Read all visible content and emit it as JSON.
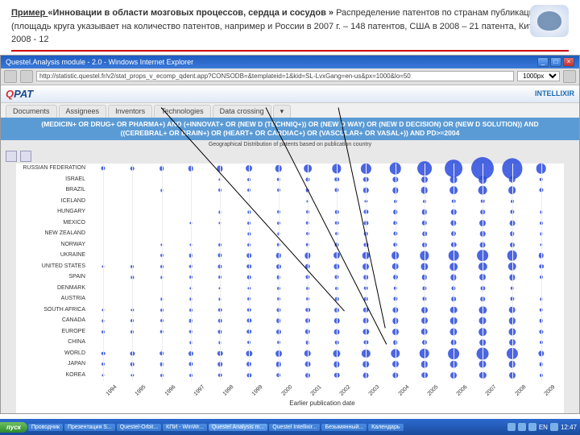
{
  "header": {
    "prefix_bold": "Пример ",
    "title_bold": "«Инновации в области мозговых процессов, сердца и сосудов »",
    "suffix": " Распределение патентов по странам публикации (площадь круга указывает на количество патентов, например и России в 2007 г. – 148 патентов, США в 2008 – 21 патента, Китай в 2008 - 12"
  },
  "browser": {
    "window_title": "Questel.Analysis module - 2.0 - Windows Internet Explorer",
    "address": "http://statistic.questel.fr/v2/stat_props_v_ecomp_qdent.app?CONSODB=&templateid=1&kid=SL-LvxGang=en-us&px=1000&lo=50",
    "dropdown_value": "1000px"
  },
  "app": {
    "logo_q": "Q",
    "logo_rest": "PAT",
    "brand": "INTELLIXIR",
    "tabs": [
      "Documents",
      "Assignees",
      "Inventors",
      "Technologies",
      "Data crossing",
      "▾"
    ]
  },
  "query": {
    "line1": "(MEDICIN+ OR DRUG+ OR PHARMA+) AND (+INNOVAT+ OR (NEW D (TECHNIQ+)) OR (NEW D WAY) OR (NEW D DECISION) OR (NEW D SOLUTION)) AND",
    "line2": "((CEREBRAL+ OR BRAIN+) OR (HEART+ OR CARDIAC+) OR (VASCULAR+ OR VASAL+)) AND PD>=2004"
  },
  "chart": {
    "subtitle": "Geographical Distribution of patents based on publication country",
    "xlabel": "Earlier publication date"
  },
  "chart_data": {
    "type": "bubble",
    "xlabel": "Earlier publication date",
    "ylabel": "Country",
    "x": [
      "1994",
      "1995",
      "1996",
      "1997",
      "1998",
      "1999",
      "2000",
      "2001",
      "2002",
      "2003",
      "2004",
      "2005",
      "2006",
      "2007",
      "2008",
      "2009"
    ],
    "series": [
      {
        "name": "RUSSIAN FEDERATION",
        "values": [
          5,
          4,
          6,
          8,
          10,
          12,
          14,
          18,
          24,
          28,
          40,
          60,
          90,
          148,
          120,
          30
        ]
      },
      {
        "name": "ISRAEL",
        "values": [
          0,
          0,
          0,
          0,
          2,
          3,
          4,
          5,
          6,
          8,
          10,
          12,
          15,
          18,
          14,
          4
        ]
      },
      {
        "name": "BRAZIL",
        "values": [
          0,
          0,
          2,
          0,
          3,
          3,
          3,
          4,
          5,
          8,
          10,
          14,
          18,
          22,
          18,
          5
        ]
      },
      {
        "name": "ICELAND",
        "values": [
          0,
          0,
          0,
          0,
          0,
          0,
          0,
          2,
          0,
          2,
          3,
          3,
          4,
          4,
          3,
          0
        ]
      },
      {
        "name": "HUNGARY",
        "values": [
          0,
          0,
          0,
          0,
          2,
          2,
          3,
          3,
          4,
          5,
          6,
          8,
          8,
          6,
          5,
          2
        ]
      },
      {
        "name": "MEXICO",
        "values": [
          0,
          0,
          0,
          2,
          2,
          3,
          3,
          4,
          4,
          5,
          6,
          8,
          10,
          12,
          9,
          3
        ]
      },
      {
        "name": "NEW ZEALAND",
        "values": [
          0,
          0,
          0,
          0,
          0,
          2,
          2,
          3,
          3,
          4,
          5,
          6,
          7,
          8,
          6,
          2
        ]
      },
      {
        "name": "NORWAY",
        "values": [
          0,
          0,
          2,
          2,
          3,
          3,
          4,
          4,
          5,
          5,
          6,
          7,
          8,
          9,
          7,
          2
        ]
      },
      {
        "name": "UKRAINE",
        "values": [
          0,
          0,
          3,
          4,
          5,
          6,
          8,
          10,
          12,
          14,
          18,
          24,
          30,
          36,
          30,
          8
        ]
      },
      {
        "name": "UNITED STATES",
        "values": [
          2,
          3,
          3,
          4,
          5,
          6,
          7,
          8,
          10,
          12,
          14,
          16,
          18,
          20,
          21,
          6
        ]
      },
      {
        "name": "SPAIN",
        "values": [
          0,
          2,
          2,
          3,
          3,
          4,
          4,
          5,
          5,
          6,
          7,
          8,
          10,
          12,
          10,
          3
        ]
      },
      {
        "name": "DENMARK",
        "values": [
          0,
          0,
          0,
          2,
          2,
          2,
          3,
          3,
          3,
          4,
          4,
          5,
          5,
          5,
          4,
          0
        ]
      },
      {
        "name": "AUSTRIA",
        "values": [
          0,
          0,
          2,
          2,
          2,
          3,
          3,
          3,
          4,
          4,
          5,
          5,
          6,
          6,
          5,
          2
        ]
      },
      {
        "name": "SOUTH AFRICA",
        "values": [
          2,
          2,
          3,
          3,
          4,
          4,
          5,
          6,
          7,
          8,
          10,
          12,
          14,
          16,
          14,
          4
        ]
      },
      {
        "name": "CANADA",
        "values": [
          2,
          3,
          3,
          4,
          4,
          5,
          6,
          7,
          8,
          9,
          10,
          12,
          14,
          15,
          13,
          4
        ]
      },
      {
        "name": "EUROPE",
        "values": [
          3,
          3,
          4,
          4,
          5,
          6,
          7,
          8,
          9,
          10,
          12,
          14,
          16,
          18,
          16,
          5
        ]
      },
      {
        "name": "CHINA",
        "values": [
          0,
          0,
          0,
          2,
          2,
          3,
          3,
          4,
          4,
          5,
          6,
          7,
          9,
          11,
          12,
          3
        ]
      },
      {
        "name": "WORLD",
        "values": [
          4,
          5,
          6,
          7,
          8,
          10,
          12,
          14,
          16,
          20,
          25,
          30,
          36,
          42,
          38,
          10
        ]
      },
      {
        "name": "JAPAN",
        "values": [
          3,
          4,
          4,
          5,
          6,
          7,
          8,
          9,
          10,
          11,
          12,
          13,
          14,
          15,
          14,
          4
        ]
      },
      {
        "name": "KOREA",
        "values": [
          2,
          2,
          3,
          3,
          4,
          5,
          6,
          7,
          8,
          9,
          10,
          11,
          12,
          13,
          12,
          3
        ]
      }
    ]
  },
  "taskbar": {
    "start": "пуск",
    "items": [
      "Проводник",
      "Презентация S...",
      "Questel-Orbit...",
      "КПИ - WinWr...",
      "Questel Analysis m...",
      "Questel Intellixir...",
      "Безымянный...",
      "Календарь"
    ],
    "lang": "EN",
    "clock": "12:47"
  }
}
